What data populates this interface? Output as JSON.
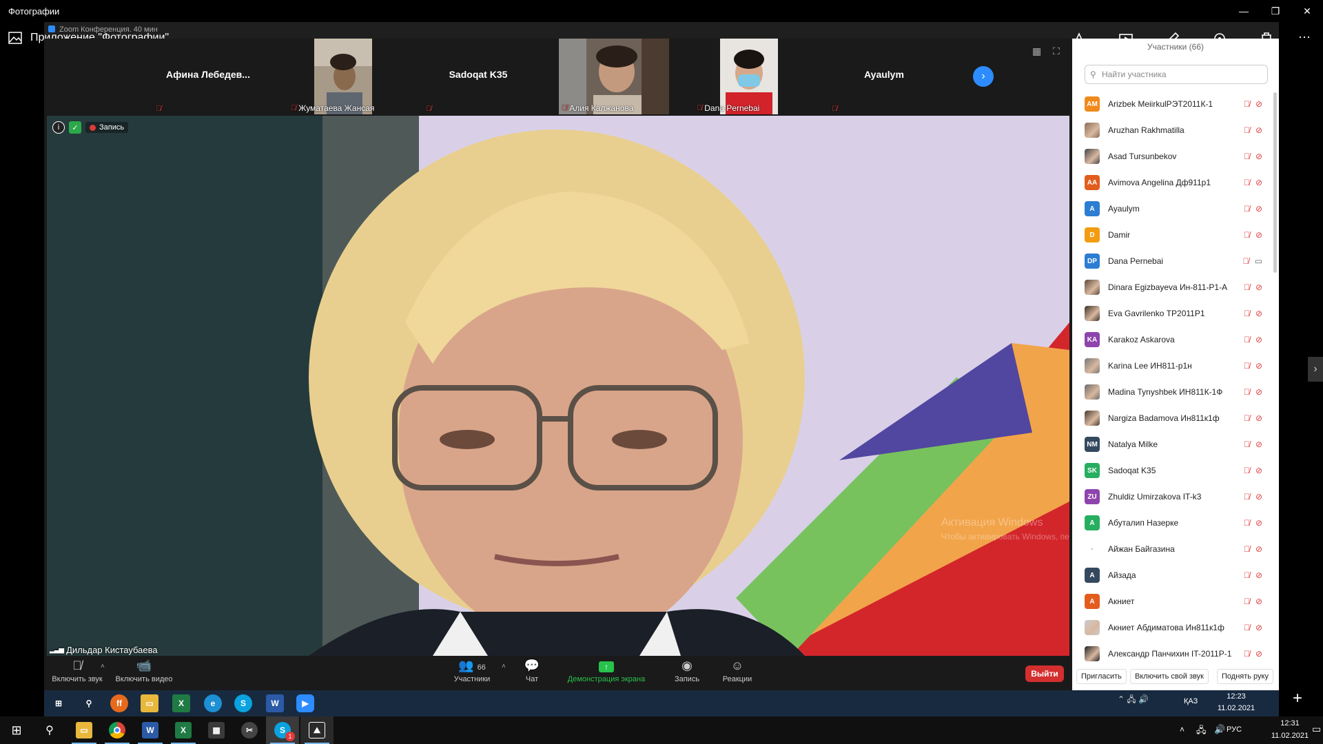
{
  "photos": {
    "window_title": "Фотографии",
    "app_label": "Приложение \"Фотографии\"",
    "controls": {
      "minimize": "—",
      "maximize": "❐",
      "close": "✕"
    }
  },
  "zoom": {
    "window_title": "Zoom Конференция. 40 мин",
    "strip": [
      {
        "name": "Афина  Лебедев...",
        "type": "name"
      },
      {
        "name": "Жуматаева Жансая",
        "type": "video"
      },
      {
        "name": "Sadoqat K35",
        "type": "name"
      },
      {
        "name": "Алия Калжанова",
        "type": "video"
      },
      {
        "name": "Dana Pernebai",
        "type": "video"
      },
      {
        "name": "Ayaulym",
        "type": "name"
      }
    ],
    "recording_label": "Запись",
    "speaker_name": "Дильдар Кистаубаева",
    "watermark_line1": "Активация Windows",
    "watermark_line2": "Чтобы активировать Windows, перейдите",
    "toolbar": {
      "mute": "Включить звук",
      "video": "Включить видео",
      "participants": "Участники",
      "participants_count": "66",
      "chat": "Чат",
      "share": "Демонстрация экрана",
      "record": "Запись",
      "reactions": "Реакции",
      "leave": "Выйти"
    }
  },
  "participants_panel": {
    "header": "Участники (66)",
    "search_placeholder": "Найти участника",
    "rows": [
      {
        "initials": "AM",
        "color": "#f08a1c",
        "name": "Arizbek MeiirkulРЭТ2011К-1"
      },
      {
        "initials": "",
        "color": "#8a6d5b",
        "name": "Aruzhan Rakhmatilla",
        "photo": true
      },
      {
        "initials": "",
        "color": "#444444",
        "name": "Asad Tursunbekov",
        "photo": true
      },
      {
        "initials": "AA",
        "color": "#e25c1e",
        "name": "Avimova Angelina Дф911р1"
      },
      {
        "initials": "A",
        "color": "#2d7dd2",
        "name": "Ayaulym"
      },
      {
        "initials": "D",
        "color": "#f39c12",
        "name": "Damir"
      },
      {
        "initials": "DP",
        "color": "#2d7dd2",
        "name": "Dana Pernebai",
        "cam_on": true
      },
      {
        "initials": "",
        "color": "#5c4a3d",
        "name": "Dinara Egizbayeva Ин-811-Р1-А",
        "photo": true
      },
      {
        "initials": "",
        "color": "#3b2f24",
        "name": "Eva Gavrilenko ТР2011Р1",
        "photo": true
      },
      {
        "initials": "KA",
        "color": "#8e44ad",
        "name": "Karakoz Askarova"
      },
      {
        "initials": "",
        "color": "#777777",
        "name": "Karina Lee ИН811-р1н",
        "photo": true
      },
      {
        "initials": "",
        "color": "#6b6b6b",
        "name": "Madina Tynyshbek ИН811К-1Ф",
        "photo": true
      },
      {
        "initials": "",
        "color": "#4a3a30",
        "name": "Nargiza Badamova Ин811к1ф",
        "photo": true
      },
      {
        "initials": "NM",
        "color": "#34495e",
        "name": "Natalya Milke"
      },
      {
        "initials": "SK",
        "color": "#27ae60",
        "name": "Sadoqat K35"
      },
      {
        "initials": "ZU",
        "color": "#8e44ad",
        "name": "Zhuldiz Umirzakova IT-k3"
      },
      {
        "initials": "A",
        "color": "#27ae60",
        "name": "Абуталип Назерке"
      },
      {
        "initials": "·",
        "color": "#ffffff",
        "name": "Айжан Байгазина"
      },
      {
        "initials": "A",
        "color": "#34495e",
        "name": "Айзада"
      },
      {
        "initials": "A",
        "color": "#e25c1e",
        "name": "Акниет"
      },
      {
        "initials": "",
        "color": "#cccccc",
        "name": "Акниет Абдиматова  Ин811к1ф",
        "photo": true
      },
      {
        "initials": "",
        "color": "#222222",
        "name": "Александр Панчихин IT-2011Р-1",
        "photo": true
      }
    ],
    "footer": {
      "invite": "Пригласить",
      "unmute_me": "Включить свой звук",
      "raise_hand": "Поднять руку"
    }
  },
  "inner_taskbar": {
    "time": "12:23",
    "date": "11.02.2021",
    "lang": "ҚАЗ"
  },
  "taskbar": {
    "time": "12:31",
    "date": "11.02.2021",
    "lang": "РУС",
    "notification_count": "1"
  }
}
